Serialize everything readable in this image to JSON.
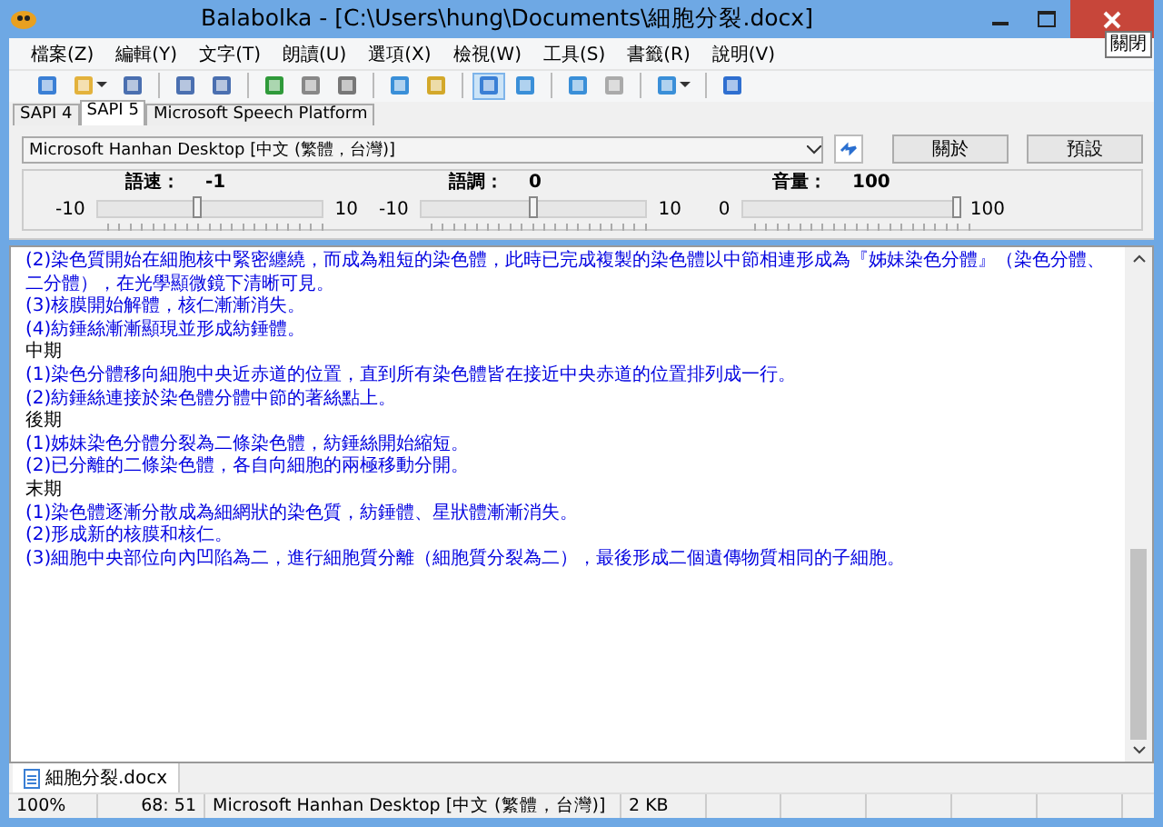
{
  "window": {
    "title": "Balabolka - [C:\\Users\\hung\\Documents\\細胞分裂.docx]",
    "tooltip": "關閉"
  },
  "menu": [
    "檔案(Z)",
    "編輯(Y)",
    "文字(T)",
    "朗讀(U)",
    "選項(X)",
    "檢視(W)",
    "工具(S)",
    "書籤(R)",
    "說明(V)"
  ],
  "toolbar": [
    {
      "kind": "button",
      "pressed": false
    },
    {
      "kind": "dropdown",
      "pressed": false
    },
    {
      "kind": "button",
      "pressed": false
    },
    {
      "kind": "separator"
    },
    {
      "kind": "button",
      "pressed": false
    },
    {
      "kind": "button",
      "pressed": false
    },
    {
      "kind": "separator"
    },
    {
      "kind": "button",
      "pressed": false
    },
    {
      "kind": "button",
      "pressed": false
    },
    {
      "kind": "button",
      "pressed": false
    },
    {
      "kind": "separator"
    },
    {
      "kind": "button",
      "pressed": false
    },
    {
      "kind": "button",
      "pressed": false
    },
    {
      "kind": "separator"
    },
    {
      "kind": "button",
      "pressed": true
    },
    {
      "kind": "button",
      "pressed": false
    },
    {
      "kind": "separator"
    },
    {
      "kind": "button",
      "pressed": false
    },
    {
      "kind": "button",
      "pressed": false
    },
    {
      "kind": "separator"
    },
    {
      "kind": "dropdown",
      "pressed": false
    },
    {
      "kind": "separator"
    },
    {
      "kind": "button",
      "pressed": false
    }
  ],
  "engine_tabs": [
    {
      "label": "SAPI 4",
      "selected": false
    },
    {
      "label": "SAPI 5",
      "selected": true
    },
    {
      "label": "Microsoft Speech Platform",
      "selected": false
    }
  ],
  "voice": {
    "value": "Microsoft Hanhan Desktop [中文 (繁體，台灣)]",
    "buttons": [
      "關於",
      "預設"
    ]
  },
  "sliders": [
    {
      "label": "語速：",
      "reading": "-1",
      "min": "-10",
      "max": "10",
      "level": 0.45
    },
    {
      "label": "語調：",
      "reading": "0",
      "min": "-10",
      "max": "10",
      "level": 0.5
    },
    {
      "label": "音量：",
      "reading": "100",
      "min": "0",
      "max": "100",
      "level": 1
    }
  ],
  "text_lines": [
    {
      "kind": "item",
      "text": "(2)染色質開始在細胞核中緊密纏繞，而成為粗短的染色體，此時已完成複製的染色體以中節相連形成為『姊妹染色分體』（染色分體、二分體），在光學顯微鏡下清晰可見。"
    },
    {
      "kind": "item",
      "text": "(3)核膜開始解體，核仁漸漸消失。"
    },
    {
      "kind": "item",
      "text": "(4)紡錘絲漸漸顯現並形成紡錘體。"
    },
    {
      "kind": "heading",
      "text": "中期"
    },
    {
      "kind": "item",
      "text": "(1)染色分體移向細胞中央近赤道的位置，直到所有染色體皆在接近中央赤道的位置排列成一行。"
    },
    {
      "kind": "item",
      "text": "(2)紡錘絲連接於染色體分體中節的著絲點上。"
    },
    {
      "kind": "heading",
      "text": "後期"
    },
    {
      "kind": "item",
      "text": "(1)姊妹染色分體分裂為二條染色體，紡錘絲開始縮短。"
    },
    {
      "kind": "item",
      "text": "(2)已分離的二條染色體，各自向細胞的兩極移動分開。"
    },
    {
      "kind": "heading",
      "text": "末期"
    },
    {
      "kind": "item",
      "text": "(1)染色體逐漸分散成為細網狀的染色質，紡錘體、星狀體漸漸消失。"
    },
    {
      "kind": "item",
      "text": "(2)形成新的核膜和核仁。"
    },
    {
      "kind": "item",
      "text": "(3)細胞中央部位向內凹陷為二，進行細胞質分離（細胞質分裂為二），最後形成二個遺傳物質相同的子細胞。"
    }
  ],
  "document_tabs": [
    {
      "label": "細胞分裂.docx",
      "selected": true
    }
  ],
  "status_bar": [
    "100%",
    "68:  51",
    "Microsoft Hanhan Desktop [中文 (繁體，台灣)]",
    "2 KB"
  ]
}
